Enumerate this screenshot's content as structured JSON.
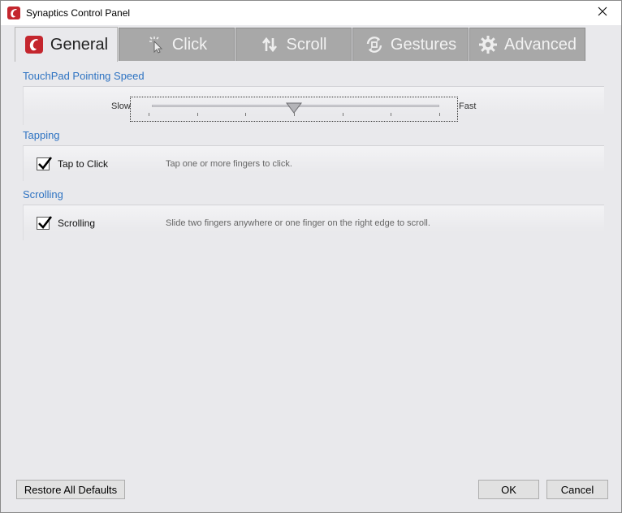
{
  "window": {
    "title": "Synaptics Control Panel"
  },
  "tabs": [
    {
      "label": "General",
      "icon": "synaptics-logo-icon",
      "active": true
    },
    {
      "label": "Click",
      "icon": "cursor-click-icon",
      "active": false
    },
    {
      "label": "Scroll",
      "icon": "scroll-arrows-icon",
      "active": false
    },
    {
      "label": "Gestures",
      "icon": "gestures-icon",
      "active": false
    },
    {
      "label": "Advanced",
      "icon": "gear-icon",
      "active": false
    }
  ],
  "pointing_speed": {
    "title": "TouchPad Pointing Speed",
    "slow_label": "Slow",
    "fast_label": "Fast",
    "level_fraction": 0.5,
    "ticks": 7
  },
  "tapping": {
    "title": "Tapping",
    "checkbox_label": "Tap to Click",
    "checked": true,
    "description": "Tap one or more fingers to click."
  },
  "scrolling": {
    "title": "Scrolling",
    "checkbox_label": "Scrolling",
    "checked": true,
    "description": "Slide two fingers anywhere or one finger on the right edge to scroll."
  },
  "buttons": {
    "restore_label": "Restore All Defaults",
    "ok_label": "OK",
    "cancel_label": "Cancel"
  },
  "colors": {
    "accent": "#2e73c2",
    "brand": "#c4262e",
    "tab_inactive": "#a8a8a8",
    "panel_bg": "#e9e9ec"
  }
}
